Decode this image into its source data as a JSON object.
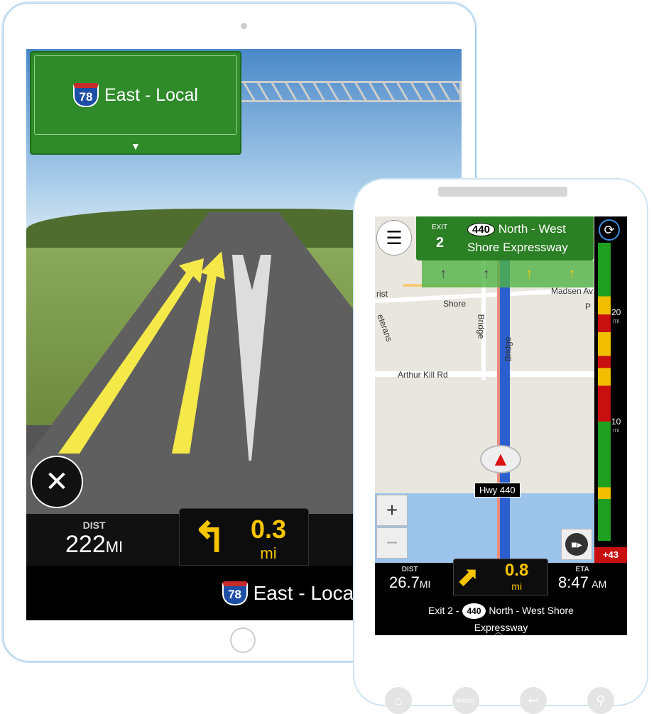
{
  "tablet": {
    "sign": {
      "shield": "78",
      "text": "East - Local"
    },
    "bottom": {
      "dist_label": "DIST",
      "dist_value": "222",
      "dist_unit": "MI",
      "turn_distance": "0.3",
      "turn_unit": "mi",
      "next_road_shield": "78",
      "next_road": "East - Local"
    }
  },
  "phone": {
    "sign": {
      "exit_label": "EXIT",
      "exit_number": "2",
      "shield": "440",
      "line1": "North - West",
      "line2": "Shore Expressway"
    },
    "lanes": [
      "↑",
      "↑",
      "↑",
      "↑"
    ],
    "map_labels": [
      "rist",
      "Shore",
      "Bridge",
      "Madsen Av",
      "P",
      "eterans",
      "Arthur Kill Rd",
      "Bridge"
    ],
    "current_road": "Hwy 440",
    "traffic": {
      "mark1": "20",
      "mark2": "10",
      "unit": "mi",
      "delay": "+43"
    },
    "zoom_in": "+",
    "zoom_out": "−",
    "bottom": {
      "dist_label": "DIST",
      "dist_value": "26.7",
      "dist_unit": "MI",
      "turn_distance": "0.8",
      "turn_unit": "mi",
      "eta_label": "ETA",
      "eta_value": "8:47",
      "eta_unit": "AM",
      "instruction_prefix": "Exit 2 -",
      "instruction_shield": "440",
      "instruction_line1": "North - West Shore",
      "instruction_line2": "Expressway"
    },
    "softkeys": {
      "home": "⌂",
      "menu": "menu",
      "back": "↩",
      "search": "⚲"
    }
  },
  "colors": {
    "sign_green": "#2f8a2a",
    "accent_yellow": "#f6c400",
    "route_blue": "#2b5fce",
    "traffic_red": "#c81010"
  }
}
